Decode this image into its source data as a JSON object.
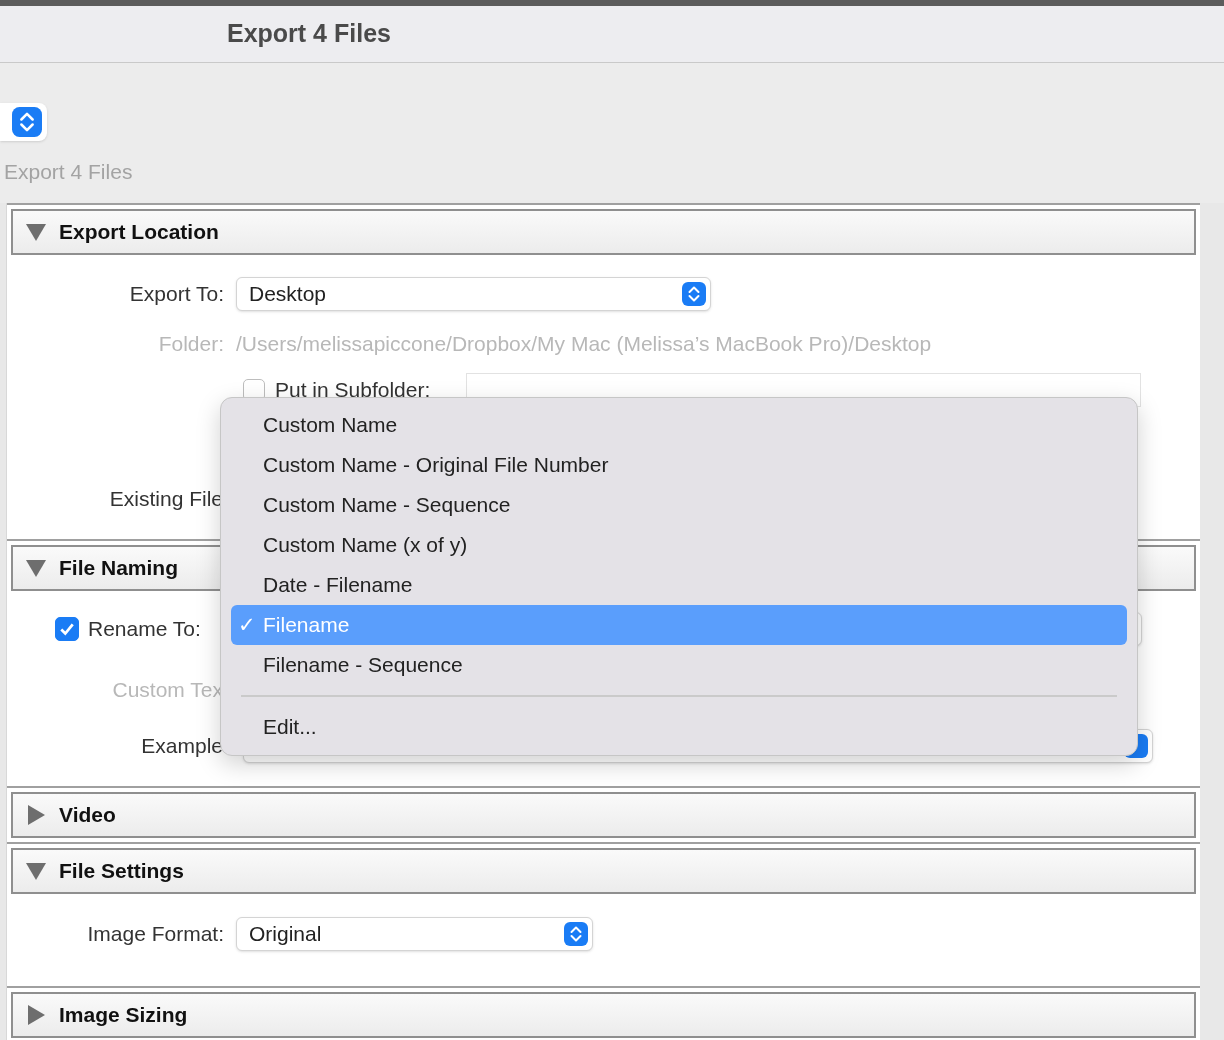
{
  "window": {
    "title": "Export 4 Files"
  },
  "preset_label": "Export 4 Files",
  "sections": [
    {
      "title": "Export Location",
      "expanded": true,
      "rows": [
        {
          "kind": "popup",
          "label": "Export To:",
          "value": "Desktop"
        },
        {
          "kind": "path",
          "label": "Folder:",
          "value": "/Users/melissapiccone/Dropbox/My Mac (Melissa’s MacBook Pro)/Desktop",
          "disabled": true
        },
        {
          "kind": "checkbox_field",
          "label": "Put in Subfolder:",
          "checked": false
        },
        {
          "kind": "label",
          "label": "Existing File",
          "disabled": false
        }
      ]
    },
    {
      "title": "File Naming",
      "expanded": true,
      "rows": [
        {
          "kind": "checkbox_popup",
          "label": "Rename To:",
          "checked": true
        },
        {
          "kind": "label",
          "label": "Custom Tex",
          "disabled": true
        },
        {
          "kind": "label_popup",
          "label": "Example"
        }
      ]
    },
    {
      "title": "Video",
      "expanded": false
    },
    {
      "title": "File Settings",
      "expanded": true,
      "rows": [
        {
          "kind": "popup",
          "label": "Image Format:",
          "value": "Original"
        }
      ]
    },
    {
      "title": "Image Sizing",
      "expanded": false
    }
  ],
  "menu": {
    "items": [
      {
        "label": "Custom Name",
        "selected": false
      },
      {
        "label": "Custom Name - Original File Number",
        "selected": false
      },
      {
        "label": "Custom Name - Sequence",
        "selected": false
      },
      {
        "label": "Custom Name (x of y)",
        "selected": false
      },
      {
        "label": "Date - Filename",
        "selected": false
      },
      {
        "label": "Filename",
        "selected": true
      },
      {
        "label": "Filename - Sequence",
        "selected": false
      }
    ],
    "check": "✓",
    "edit": "Edit..."
  }
}
